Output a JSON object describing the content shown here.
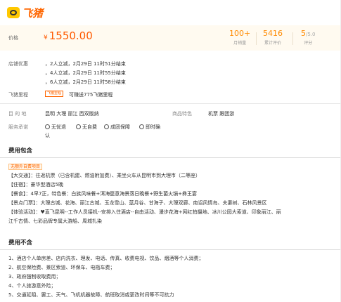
{
  "brand": {
    "name": "飞猪"
  },
  "price": {
    "label": "价格",
    "currency": "¥",
    "value": "1550.00",
    "stats": [
      {
        "value": "100+",
        "label": "月销量"
      },
      {
        "value": "5416",
        "label": "累计评价"
      },
      {
        "value": "5",
        "suffix": "/5.0",
        "label": "评分"
      }
    ]
  },
  "promo": {
    "label": "店铺优惠",
    "lines": [
      "，2人立减，2月29日 11时51分结束",
      "，4人立减，2月29日 11时55分结束",
      "，6人立减，2月29日 11时58分结束"
    ]
  },
  "miles": {
    "label": "飞猪里程",
    "tag": "飞猪里程",
    "text": "可赚送775飞猪里程"
  },
  "meta": {
    "destination_label": "目 的 地",
    "destination_value": "昆明 大理 丽江 西双版纳",
    "feature_label": "商品特色",
    "feature_value": "机票 跟团游",
    "service_label": "服务承诺",
    "services": [
      "无忧退",
      "无自费",
      "成团保障",
      "即时确"
    ],
    "services_wrap": "认"
  },
  "included": {
    "title": "费用包含",
    "tag": "无额外自费项目",
    "lines": [
      "【大交通】：往返机票（已含机建、燃油附加费）、乘坐火车从昆明市到大理市（二等座）",
      "【住宿】：豪华型酒店5晚",
      "【餐食】：4早7正，特色餐：白族风味餐+洱海筵意海景落日晚餐+野生菌火锅+彝王宴",
      "【景点门票】：大理古城、花海、丽江古城、玉龙雪山、蓝月谷、甘海子、大理双廊、南诏风情岛、夫妻树、石林风景区",
      "【体验活动】：♥直飞昆明--工作人员接机--安排入住酒店--自由活动、漫步花海+网红拍摄地、冰川公园大索道、印象丽江、丽",
      "江千古情、七彩品牌专属大游船、周城扎染"
    ]
  },
  "excluded": {
    "title": "费用不含",
    "lines": [
      "1、酒店个人单房差、店内洗衣、理发、电话、传真、收费电视、饮品、烟酒等个人消费；",
      "2、航空保险费、景区索道、环保车、电瓶车费；",
      "3、政府强制收取费用；",
      "4、个人旅游意外险；",
      "5、交通延阻、罢工、天气、飞机机器故障、航班取消或更改时间等不可抗力"
    ]
  },
  "colors": {
    "accent": "#ff6600",
    "price": "#ff5a00",
    "stat": "#ff8a00",
    "price_bg": "#fffaf0"
  }
}
